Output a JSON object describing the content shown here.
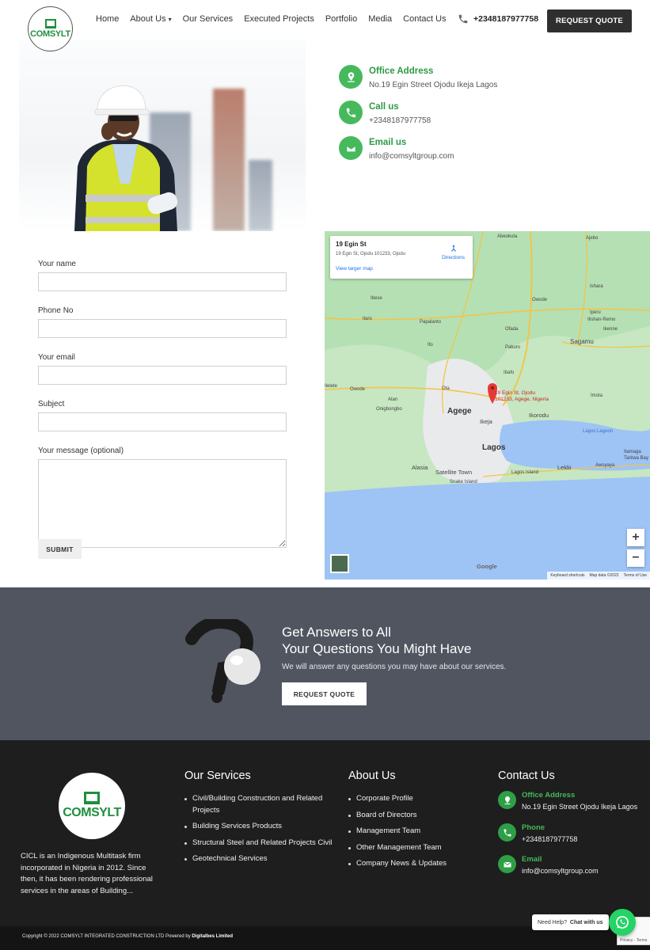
{
  "header": {
    "logo_text": "COMSYLT",
    "nav": [
      {
        "label": "Home"
      },
      {
        "label": "About Us",
        "has_dropdown": true
      },
      {
        "label": "Our Services"
      },
      {
        "label": "Executed Projects"
      },
      {
        "label": "Portfolio"
      },
      {
        "label": "Media"
      },
      {
        "label": "Contact Us"
      }
    ],
    "phone": "+2348187977758",
    "cta_label": "REQUEST QUOTE"
  },
  "contact_info": [
    {
      "title": "Office Address",
      "value": "No.19 Egin Street Ojodu Ikeja Lagos",
      "icon": "location-icon"
    },
    {
      "title": "Call us",
      "value": "+2348187977758",
      "icon": "phone-icon"
    },
    {
      "title": "Email us",
      "value": "info@comsyltgroup.com",
      "icon": "mail-icon"
    }
  ],
  "form": {
    "fields": [
      {
        "label": "Your name",
        "value": ""
      },
      {
        "label": "Phone No",
        "value": ""
      },
      {
        "label": "Your email",
        "value": ""
      },
      {
        "label": "Subject",
        "value": ""
      }
    ],
    "message_label": "Your message (optional)",
    "submit_label": "SUBMIT"
  },
  "map": {
    "place_title": "19 Egin St",
    "place_address": "19 Egin St, Ojodu 101233, Ojodu",
    "directions_label": "Directions",
    "larger_map_label": "View larger map",
    "pin_label_1": "19 Egin St, Ojodu",
    "pin_label_2": "101233, Agege, Nigeria",
    "labels": {
      "abeokuta": "Abeokuta",
      "ajebo": "Ajebo",
      "ishara": "Ishara",
      "owode_n": "Owode",
      "ibese": "Ibese",
      "ilaro": "Ilaro",
      "papalanto": "Papalanto",
      "iperu": "Iperu",
      "ilishan_remo": "Ilishan-Remo",
      "ikenne": "Ikenne",
      "ofada": "Ofada",
      "sagamu": "Sagamu",
      "ifo": "Ifo",
      "pakuro": "Pakuro",
      "ibafo": "Ibafo",
      "ilelete": "Ilelete",
      "owode_w": "Owode",
      "ota": "Ota",
      "atan": "Atan",
      "onigbongbo": "Onigbongbo",
      "agege": "Agege",
      "ikorodu": "Ikorodu",
      "imota": "Imota",
      "ikeja": "Ikeja",
      "lagos": "Lagos",
      "alasia": "Alasia",
      "satellite_town": "Satellite Town",
      "lagos_island": "Lagos Island",
      "snake_island": "Snake Island",
      "lekki": "Lekki",
      "lagos_lagoon": "Lagos Lagoon",
      "itamaga": "Itamaga",
      "tarkwa_bay": "Tarkwa Bay",
      "awoyaya": "Awoyaya"
    },
    "zoom_in": "+",
    "zoom_out": "−",
    "google": "Google",
    "keyboard": "Keyboard shortcuts",
    "map_data": "Map data ©2022",
    "terms": "Terms of Use"
  },
  "cta": {
    "title_line1": "Get Answers to All",
    "title_line2": "Your Questions You Might Have",
    "subtitle": "We will answer any questions you may have about our services.",
    "button_label": "REQUEST QUOTE"
  },
  "footer": {
    "logo_text": "COMSYLT",
    "about": "CICL is an Indigenous Multitask firm incorporated in Nigeria in 2012. Since then, it has been rendering professional services in the areas of Building...",
    "services_title": "Our Services",
    "services": [
      "Civil/Building Construction and Related Projects",
      "Building Services Products",
      "Structural Steel and Related Projects Civil",
      "Geotechnical Services"
    ],
    "about_title": "About Us",
    "about_links": [
      "Corporate Profile",
      "Board of Directors",
      "Management Team",
      "Other Management Team",
      "Company News & Updates"
    ],
    "contact_title": "Contact Us",
    "contacts": [
      {
        "title": "Office Address",
        "value": "No.19 Egin Street Ojodu Ikeja Lagos"
      },
      {
        "title": "Phone",
        "value": "+2348187977758"
      },
      {
        "title": "Email",
        "value": "info@comsyltgroup.com"
      }
    ],
    "copyright_prefix": "Copyright © 2022 COMSYLT INTEGRATED CONSTRUCTION LTD Powered by",
    "copyright_brand": "Digitalbes Limited"
  },
  "whatsapp": {
    "prefix": "Need Help?",
    "bold": "Chat with us"
  },
  "recaptcha": "Privacy - Terms",
  "colors": {
    "accent_green": "#46b95d",
    "dark_button": "#2f2f2f",
    "cta_band": "#505560",
    "footer_bg": "#1e1e1e"
  }
}
